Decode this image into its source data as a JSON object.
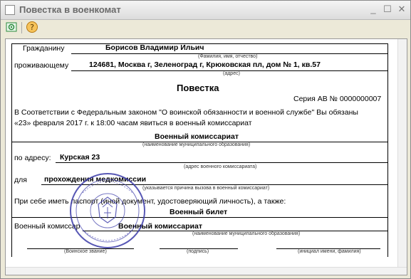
{
  "window": {
    "title": "Повестка в военкомат"
  },
  "toolbar": {
    "buttons": [
      "print-icon",
      "help-icon"
    ]
  },
  "doc": {
    "grazhdaninu_label": "Гражданину",
    "name": "Борисов Владимир Ильич",
    "name_caption": "(Фамилия, имя, отчество)",
    "prozhivayushchemu_label": "проживающему",
    "address": "124681, Москва г, Зеленоград г, Крюковская пл, дом № 1, кв.57",
    "address_caption": "(адрес)",
    "title": "Повестка",
    "series": "Серия АВ № 0000000007",
    "body_line1": "В Соответствии с Федеральным законом \"О воинской обязанности и военной службе\" Вы обязаны",
    "body_line2": "«23» февраля 2017 г. к 18:00 часам явиться в военный комиссариат",
    "commissariat": "Военный комиссариат",
    "commissariat_caption": "(наименование муниципального образования)",
    "po_adresu_label": "по адресу:",
    "commissariat_address": "Курская 23",
    "commissariat_address_caption": "(адрес военного комиссариата)",
    "dlya_label": "для",
    "purpose": "прохождения медкомиссии",
    "purpose_caption": "(указывается причина вызова в военный комиссариат)",
    "bring_text": "При себе иметь паспорт (иной документ, удостоверяющий личность), а также:",
    "bring_item": "Военный билет",
    "commissar_label": "Военный комиссар",
    "commissar_value": "Военный комиссариат",
    "commissar_caption": "(наименование муниципального образования)",
    "sig_caption_rank": "(Воинское звание)",
    "sig_caption_sign": "(подпись)",
    "sig_caption_initials": "(инициал имени, фамилия)"
  },
  "colors": {
    "stamp": "#3b3ba8",
    "title_text": "#6a6a6a"
  }
}
